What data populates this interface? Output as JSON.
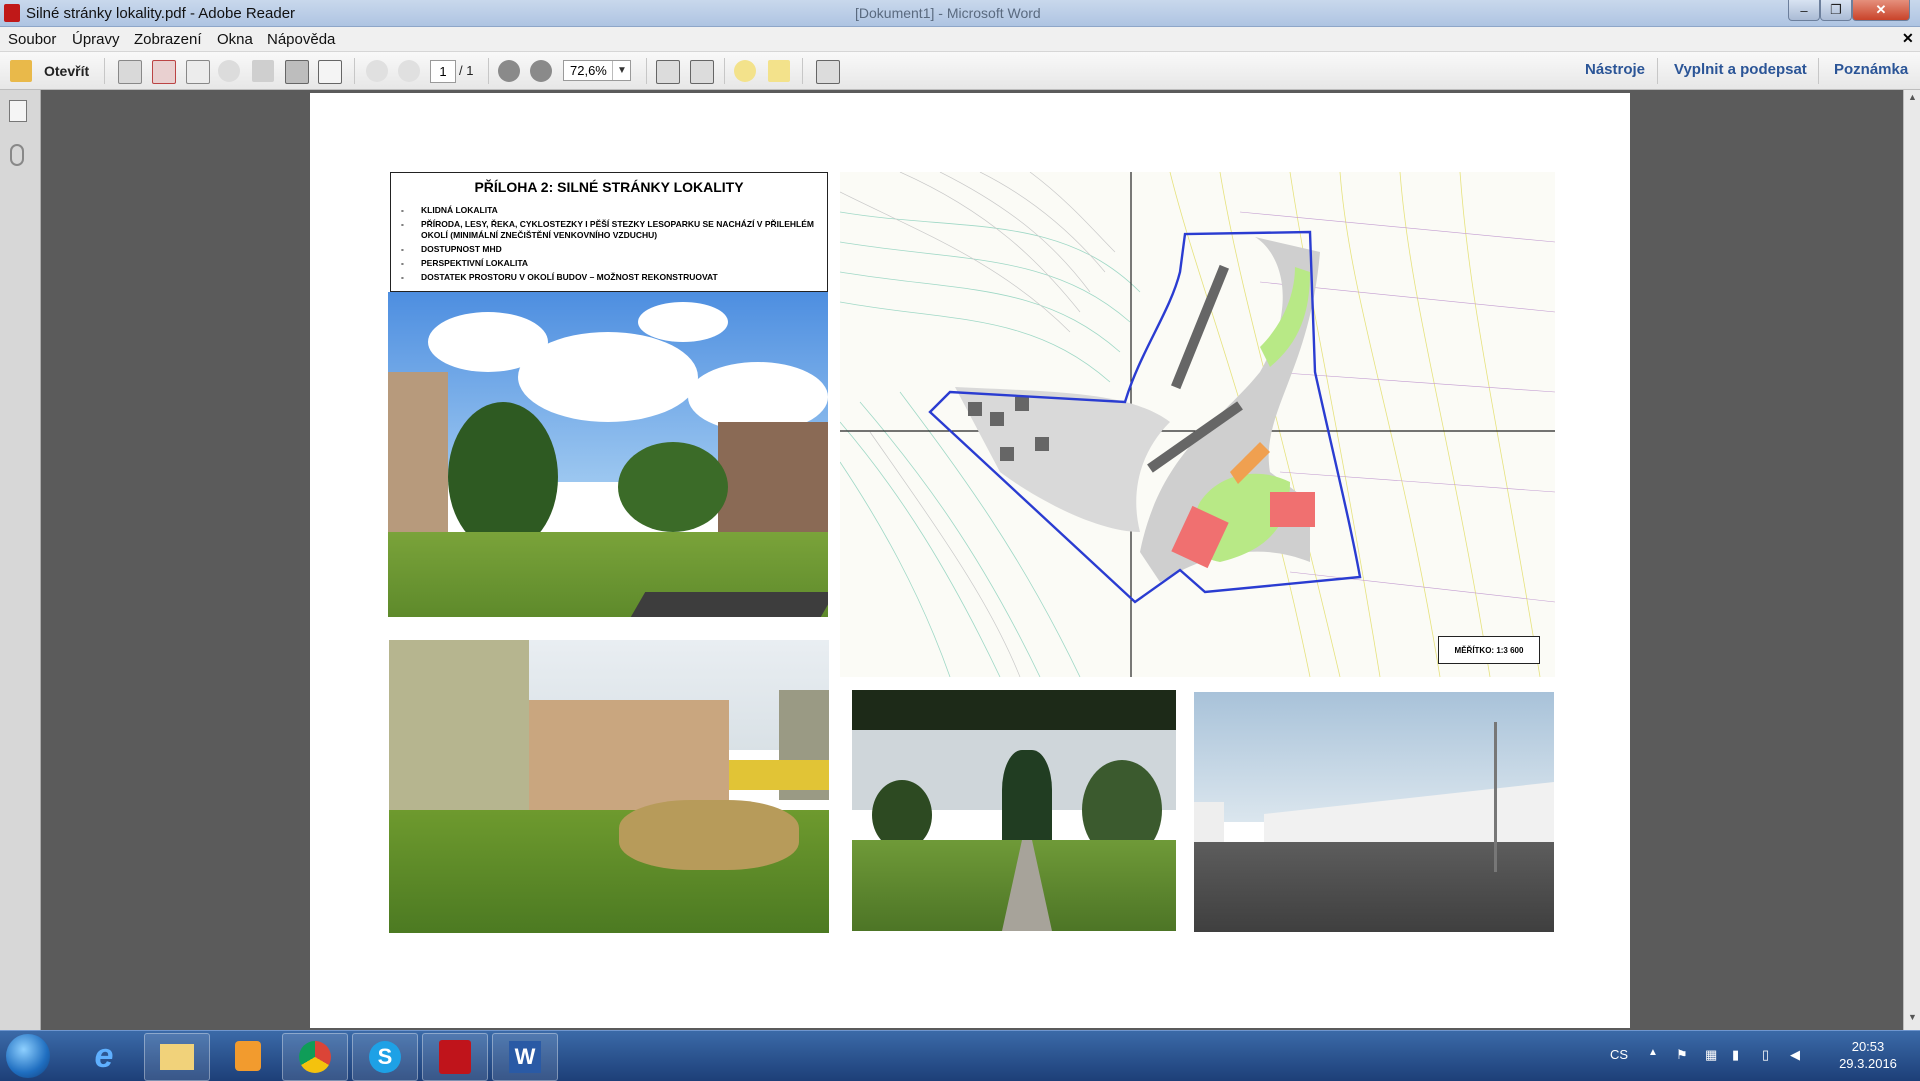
{
  "window": {
    "title": "Silné stránky lokality.pdf - Adobe Reader",
    "background_title": "[Dokument1] - Microsoft Word",
    "buttons": {
      "minimize": "–",
      "maximize": "❐",
      "close": "✕"
    }
  },
  "menu": {
    "items": [
      "Soubor",
      "Úpravy",
      "Zobrazení",
      "Okna",
      "Nápověda"
    ],
    "close": "✕"
  },
  "toolbar": {
    "open_label": "Otevřít",
    "page_current": "1",
    "page_total": "/ 1",
    "zoom": "72,6%",
    "tools": "Nástroje",
    "fill_sign": "Vyplnit a podepsat",
    "comment": "Poznámka"
  },
  "document": {
    "title": "PŘÍLOHA 2: SILNÉ STRÁNKY LOKALITY",
    "bullets": [
      "KLIDNÁ LOKALITA",
      "PŘÍRODA, LESY, ŘEKA, CYKLOSTEZKY I PĚŠÍ STEZKY LESOPARKU SE NACHÁZÍ V PŘILEHLÉM OKOLÍ (MINIMÁLNÍ ZNEČIŠTĚNÍ VENKOVNÍHO VZDUCHU)",
      "DOSTUPNOST MHD",
      "PERSPEKTIVNÍ LOKALITA",
      "DOSTATEK PROSTORU V OKOLÍ BUDOV – MOŽNOST REKONSTRUOVAT"
    ],
    "scale_label": "MĚŘÍTKO: 1:3 600"
  },
  "taskbar": {
    "language": "CS",
    "time": "20:53",
    "date": "29.3.2016",
    "apps": [
      "internet-explorer",
      "file-explorer",
      "media-player",
      "chrome",
      "skype",
      "adobe-reader",
      "word"
    ]
  },
  "colors": {
    "link": "#2b5597",
    "taskbar": "#1d3f78",
    "map_plan_green": "#b8e986",
    "map_plan_red": "#f07070",
    "map_boundary": "#2a3cd1"
  }
}
